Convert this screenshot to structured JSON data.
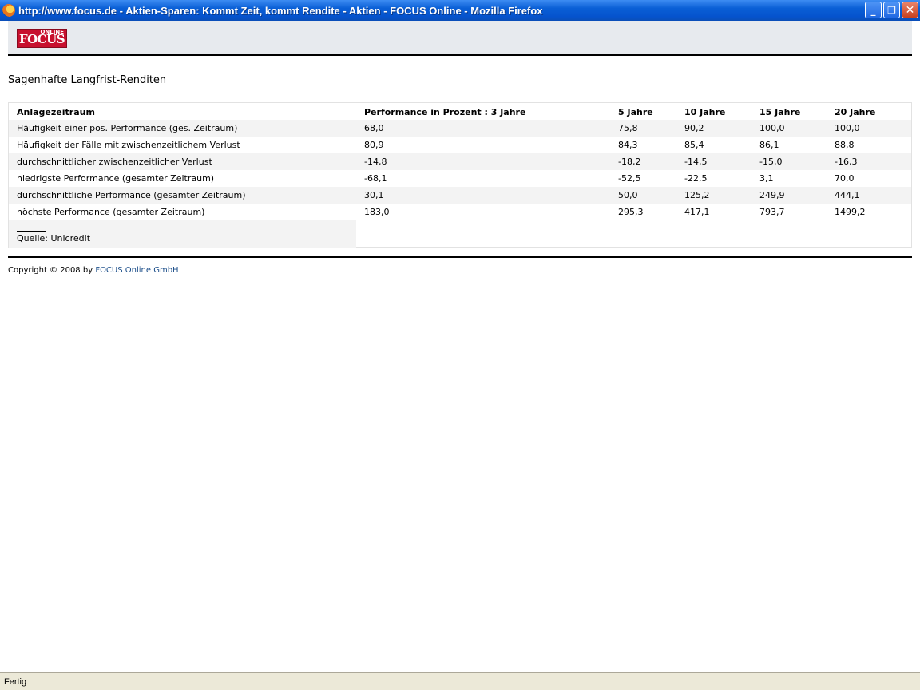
{
  "window": {
    "title": "http://www.focus.de - Aktien-Sparen: Kommt Zeit, kommt Rendite - Aktien - FOCUS Online - Mozilla Firefox",
    "minimize_glyph": "_",
    "restore_glyph": "❐",
    "close_glyph": "✕"
  },
  "logo": {
    "main": "FOCUS",
    "small": "ONLINE"
  },
  "article": {
    "title": "Sagenhafte Langfrist-Renditen"
  },
  "table": {
    "headers": [
      "Anlagezeitraum",
      "Performance in Prozent : 3 Jahre",
      "5 Jahre",
      "10 Jahre",
      "15 Jahre",
      "20 Jahre"
    ],
    "rows": [
      [
        "Häufigkeit einer pos. Performance (ges. Zeitraum)",
        "68,0",
        "75,8",
        "90,2",
        "100,0",
        "100,0"
      ],
      [
        "Häufigkeit der Fälle mit zwischenzeitlichem Verlust",
        "80,9",
        "84,3",
        "85,4",
        "86,1",
        "88,8"
      ],
      [
        "durchschnittlicher zwischenzeitlicher Verlust",
        "-14,8",
        "-18,2",
        "-14,5",
        "-15,0",
        "-16,3"
      ],
      [
        "niedrigste Performance (gesamter Zeitraum)",
        "-68,1",
        "-52,5",
        "-22,5",
        "3,1",
        "70,0"
      ],
      [
        "durchschnittliche Performance (gesamter Zeitraum)",
        "30,1",
        "50,0",
        "125,2",
        "249,9",
        "444,1"
      ],
      [
        "höchste Performance (gesamter Zeitraum)",
        "183,0",
        "295,3",
        "417,1",
        "793,7",
        "1499,2"
      ]
    ],
    "source": "Quelle: Unicredit"
  },
  "footer": {
    "copyright_prefix": "Copyright © 2008 by",
    "copyright_link": "FOCUS Online GmbH"
  },
  "statusbar": {
    "text": "Fertig"
  }
}
